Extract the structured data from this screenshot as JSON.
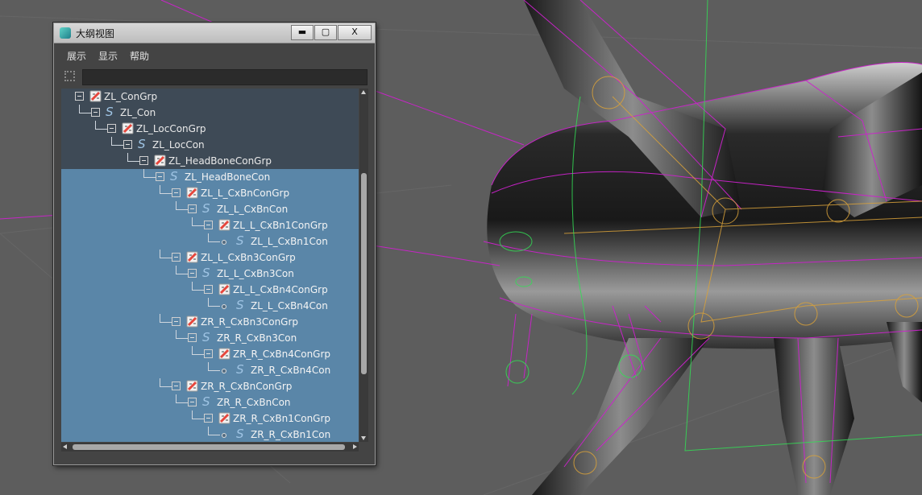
{
  "window": {
    "title": "大纲视图",
    "icon": "outliner-app-icon",
    "buttons": {
      "minimize": "▬",
      "maximize": "▢",
      "close": "X"
    }
  },
  "menu": [
    {
      "label": "展示"
    },
    {
      "label": "显示"
    },
    {
      "label": "帮助"
    }
  ],
  "filter": {
    "value": "",
    "placeholder": "",
    "icon": "filter-icon"
  },
  "tree": {
    "nodes": [
      {
        "label": "ZL_ConGrp",
        "kind": "group",
        "depth": 0,
        "state": "header"
      },
      {
        "label": "ZL_Con",
        "kind": "curve",
        "depth": 1,
        "state": "header"
      },
      {
        "label": "ZL_LocConGrp",
        "kind": "group",
        "depth": 2,
        "state": "header"
      },
      {
        "label": "ZL_LocCon",
        "kind": "curve",
        "depth": 3,
        "state": "header"
      },
      {
        "label": "ZL_HeadBoneConGrp",
        "kind": "group",
        "depth": 4,
        "state": "header"
      },
      {
        "label": "ZL_HeadBoneCon",
        "kind": "curve",
        "depth": 5,
        "state": "selected"
      },
      {
        "label": "ZL_L_CxBnConGrp",
        "kind": "group",
        "depth": 6,
        "state": "selected"
      },
      {
        "label": "ZL_L_CxBnCon",
        "kind": "curve",
        "depth": 7,
        "state": "selected"
      },
      {
        "label": "ZL_L_CxBn1ConGrp",
        "kind": "group",
        "depth": 8,
        "state": "selected"
      },
      {
        "label": "ZL_L_CxBn1Con",
        "kind": "curve-leaf",
        "depth": 9,
        "state": "selected"
      },
      {
        "label": "ZL_L_CxBn3ConGrp",
        "kind": "group",
        "depth": 6,
        "state": "selected"
      },
      {
        "label": "ZL_L_CxBn3Con",
        "kind": "curve",
        "depth": 7,
        "state": "selected"
      },
      {
        "label": "ZL_L_CxBn4ConGrp",
        "kind": "group",
        "depth": 8,
        "state": "selected"
      },
      {
        "label": "ZL_L_CxBn4Con",
        "kind": "curve-leaf",
        "depth": 9,
        "state": "selected"
      },
      {
        "label": "ZR_R_CxBn3ConGrp",
        "kind": "group",
        "depth": 6,
        "state": "selected"
      },
      {
        "label": "ZR_R_CxBn3Con",
        "kind": "curve",
        "depth": 7,
        "state": "selected"
      },
      {
        "label": "ZR_R_CxBn4ConGrp",
        "kind": "group",
        "depth": 8,
        "state": "selected"
      },
      {
        "label": "ZR_R_CxBn4Con",
        "kind": "curve-leaf",
        "depth": 9,
        "state": "selected"
      },
      {
        "label": "ZR_R_CxBnConGrp",
        "kind": "group",
        "depth": 6,
        "state": "selected"
      },
      {
        "label": "ZR_R_CxBnCon",
        "kind": "curve",
        "depth": 7,
        "state": "selected"
      },
      {
        "label": "ZR_R_CxBn1ConGrp",
        "kind": "group",
        "depth": 8,
        "state": "selected"
      },
      {
        "label": "ZR_R_CxBn1Con",
        "kind": "curve-leaf",
        "depth": 9,
        "state": "selected"
      }
    ]
  },
  "colors": {
    "viewport_bg": "#5d5d5d",
    "wireframe_selected": "#cc22cc",
    "wireframe_joint": "#d8a13a",
    "wireframe_green": "#33dd55",
    "panel_bg": "#444444",
    "tree_selected": "#5a86a8",
    "tree_header": "#3e4a56",
    "group_icon": "#e6463c"
  }
}
